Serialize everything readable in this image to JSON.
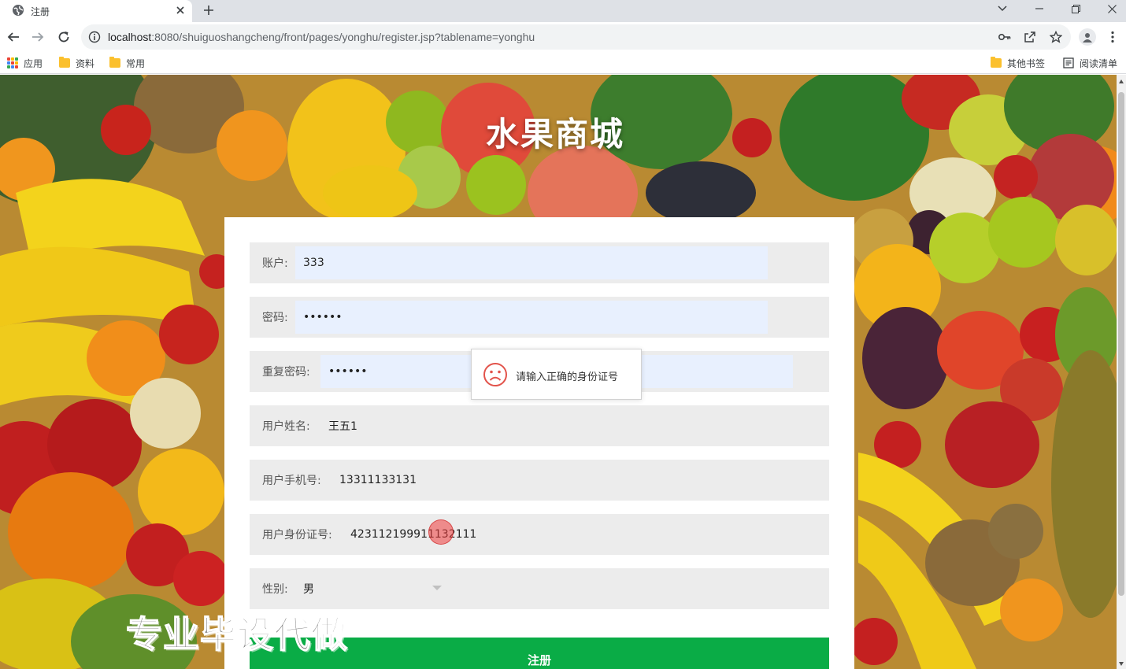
{
  "tab": {
    "title": "注册"
  },
  "address": {
    "host": "localhost",
    "rest": ":8080/shuiguoshangcheng/front/pages/yonghu/register.jsp?tablename=yonghu"
  },
  "bookmarks": {
    "apps": "应用",
    "folder1": "资料",
    "folder2": "常用",
    "other": "其他书签",
    "reading": "阅读清单"
  },
  "site": {
    "title": "水果商城"
  },
  "form": {
    "account": {
      "label": "账户:",
      "value": "333"
    },
    "password": {
      "label": "密码:",
      "value": "••••••"
    },
    "repeat_password": {
      "label": "重复密码:",
      "value": "••••••"
    },
    "name": {
      "label": "用户姓名:",
      "value": "王五1"
    },
    "phone": {
      "label": "用户手机号:",
      "value": "13311133131"
    },
    "idcard": {
      "label": "用户身份证号:",
      "value": "423112199911132111"
    },
    "gender": {
      "label": "性别:",
      "value": "男"
    },
    "submit_label": "注册"
  },
  "toast": {
    "message": "请输入正确的身份证号"
  },
  "watermark": "专业毕设代做",
  "colors": {
    "submit": "#0aac46",
    "toast_icon": "#e2534b",
    "autofill": "#e8f0fe"
  }
}
